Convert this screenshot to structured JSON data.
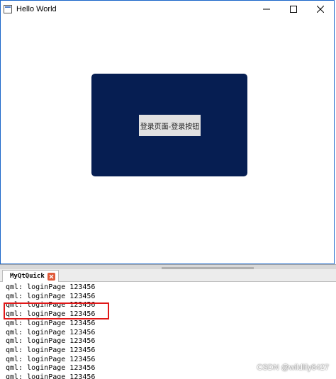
{
  "window": {
    "title": "Hello World",
    "login_button_label": "登录页面-登录按钮",
    "panel_color": "#061e52"
  },
  "ide": {
    "tab_label": "MyQtQuick",
    "log_lines": [
      "qml: loginPage 123456",
      "qml: loginPage 123456",
      "qml: loginPage 123456",
      "qml: loginPage 123456",
      "qml: loginPage 123456",
      "qml: loginPage 123456",
      "qml: loginPage 123456",
      "qml: loginPage 123456",
      "qml: loginPage 123456",
      "qml: loginPage 123456",
      "qml: loginPage 123456"
    ],
    "highlight_color": "#e01818"
  },
  "watermark": "CSDN @wildlily8427",
  "icons": {
    "app": "qt-app-icon",
    "minimize": "minimize-icon",
    "maximize": "maximize-icon",
    "close": "close-icon",
    "tab_close": "tab-close-icon"
  }
}
